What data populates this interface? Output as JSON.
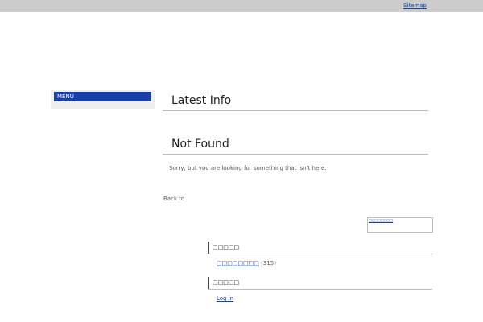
{
  "topbar": {
    "sitemap_label": "Sitemap"
  },
  "sidebar": {
    "menu_label": "MENU"
  },
  "main": {
    "latest_heading": "Latest Info",
    "notfound_heading": "Not Found",
    "notfound_message": "Sorry, but you are looking for something that isn't here.",
    "back_label": "Back to"
  },
  "widgets": {
    "search_text": "□□□□□□□□",
    "categories_title": "□□□□□",
    "category_link": "□□□□□□□□",
    "category_count": "(315)",
    "meta_title": "□□□□□",
    "login_label": "Log in"
  },
  "colors": {
    "accent": "#1a3fa8",
    "topbar": "#cccccc",
    "link": "#1a44a0"
  }
}
